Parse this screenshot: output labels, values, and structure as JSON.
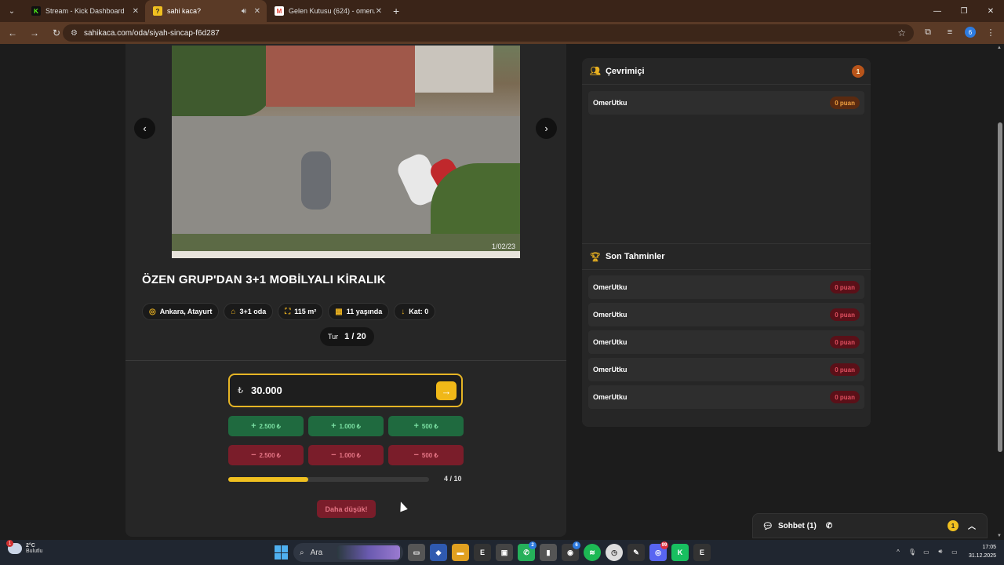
{
  "browser": {
    "tabs": [
      {
        "title": "Stream - Kick Dashboard",
        "favicon_color": "#53fc18",
        "favicon_text": "K"
      },
      {
        "title": "sahi kaca?",
        "favicon_color": "#f0c020",
        "favicon_text": "?"
      },
      {
        "title": "Gelen Kutusu (624) - omerutku",
        "favicon_color": "#ea4335",
        "favicon_text": "M"
      }
    ],
    "new_tab": "+",
    "url": "sahikaca.com/oda/siyah-sincap-f6d287",
    "profile_initial": "6"
  },
  "listing": {
    "photo_stamp": "1/02/23",
    "title": "ÖZEN GRUP'DAN 3+1 MOBİLYALI KİRALIK",
    "chips": [
      {
        "icon": "location-pin-icon",
        "glyph": "◎",
        "label": "Ankara, Atayurt"
      },
      {
        "icon": "home-icon",
        "glyph": "⌂",
        "label": "3+1 oda"
      },
      {
        "icon": "expand-icon",
        "glyph": "⛶",
        "label": "115 m²"
      },
      {
        "icon": "calendar-icon",
        "glyph": "▦",
        "label": "11 yaşında"
      },
      {
        "icon": "arrow-down-icon",
        "glyph": "↓",
        "label": "Kat: 0"
      }
    ],
    "round_label": "Tur",
    "round_value": "1 / 20"
  },
  "guess": {
    "currency": "₺",
    "value": "30.000",
    "plus_buttons": [
      "2.500 ₺",
      "1.000 ₺",
      "500 ₺"
    ],
    "minus_buttons": [
      "2.500 ₺",
      "1.000 ₺",
      "500 ₺"
    ],
    "plus_symbol": "+",
    "minus_symbol": "−",
    "progress_fraction": 0.4,
    "progress_label": "4 / 10",
    "lower_button": "Daha düşük!"
  },
  "online": {
    "title": "Çevrimiçi",
    "count": "1",
    "users": [
      {
        "name": "OmerUtku",
        "points": "0 puan"
      }
    ]
  },
  "recent_guesses": {
    "title": "Son Tahminler",
    "rows": [
      {
        "name": "OmerUtku",
        "points": "0 puan"
      },
      {
        "name": "OmerUtku",
        "points": "0 puan"
      },
      {
        "name": "OmerUtku",
        "points": "0 puan"
      },
      {
        "name": "OmerUtku",
        "points": "0 puan"
      },
      {
        "name": "OmerUtku",
        "points": "0 puan"
      }
    ]
  },
  "chat": {
    "label": "Sohbet (1)",
    "badge": "1"
  },
  "taskbar": {
    "weather_temp": "2°C",
    "weather_desc": "Bulutlu",
    "weather_badge": "1",
    "search_label": "Ara",
    "time": "17:05",
    "date": "31.12.2025",
    "chrome_badge": "6",
    "whatsapp_badge": "2",
    "discord_badge": "99"
  },
  "colors": {
    "accent": "#f0c020",
    "plus_bg": "#1f6a3f",
    "minus_bg": "#7a1d2a"
  }
}
